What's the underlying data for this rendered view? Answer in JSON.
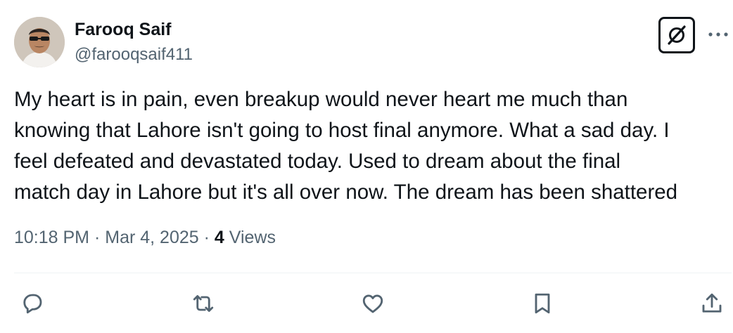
{
  "author": {
    "display_name": "Farooq Saif",
    "handle": "@farooqsaif411"
  },
  "icons": {
    "grok": "grok-icon",
    "more": "more-icon",
    "reply": "reply-icon",
    "retweet": "retweet-icon",
    "like": "like-icon",
    "bookmark": "bookmark-icon",
    "share": "share-icon"
  },
  "tweet": {
    "lines": [
      "My heart is in pain, even breakup would never heart me much than",
      "knowing that Lahore isn't going to host final anymore. What a sad day. I",
      "feel defeated and devastated today. Used to dream about the final",
      "match day in Lahore but it's all over now. The dream has been shattered"
    ],
    "time": "10:18 PM",
    "separator": "·",
    "date": "Mar 4, 2025",
    "views_count": "4",
    "views_label": "Views"
  },
  "colors": {
    "text_primary": "#0f1419",
    "text_secondary": "#536471",
    "divider": "#eff3f4"
  }
}
